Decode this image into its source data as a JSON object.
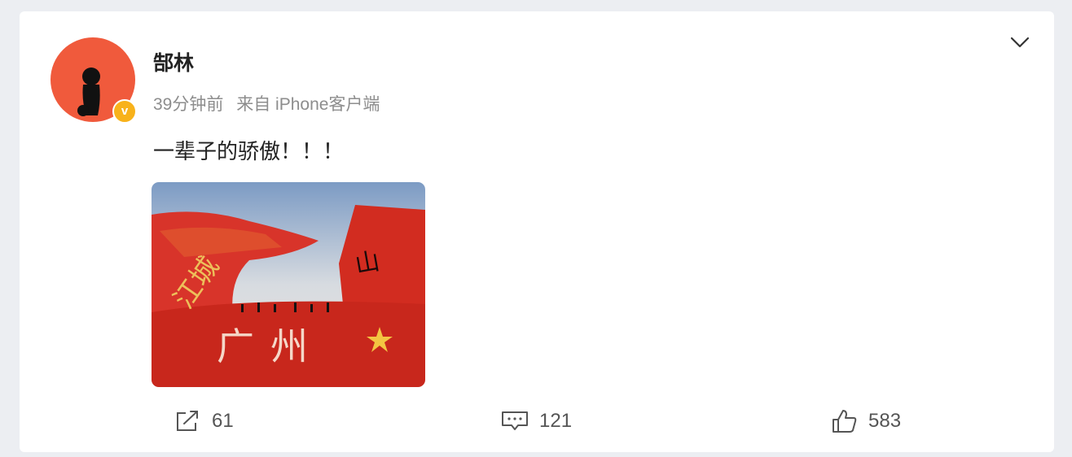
{
  "post": {
    "username": "郜林",
    "time": "39分钟前",
    "source": "来自 iPhone客户端",
    "text": "一辈子的骄傲！！！",
    "image_caption": "广州"
  },
  "actions": {
    "repost_count": "61",
    "comment_count": "121",
    "like_count": "583"
  },
  "icons": {
    "verified": "verified-v-badge-icon",
    "more": "chevron-down-icon",
    "repost": "share-icon",
    "comment": "comment-icon",
    "like": "thumbs-up-icon"
  },
  "colors": {
    "avatar_bg": "#f05a3c",
    "verified_badge": "#f8b21b",
    "flag_red": "#d42a1e"
  }
}
